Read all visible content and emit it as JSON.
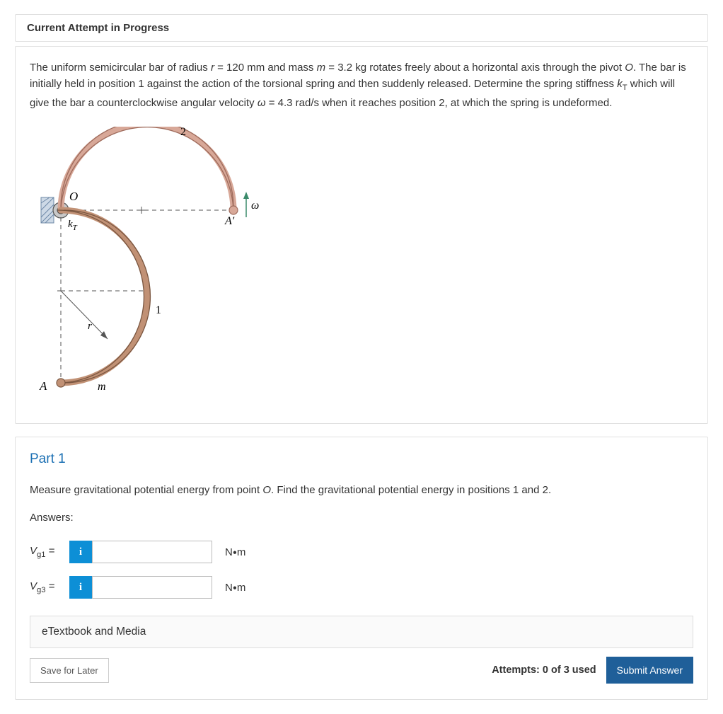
{
  "header": "Current Attempt in Progress",
  "problem": {
    "text_pre": "The uniform semicircular bar of radius ",
    "r_sym": "r",
    "r_eq": " = 120 mm and mass ",
    "m_sym": "m",
    "m_eq": " = 3.2 kg rotates freely about a horizontal axis through the pivot ",
    "O": "O",
    "text_mid1": ". The bar is initially held in position 1 against the action of the torsional spring and then suddenly released. Determine the spring stiffness ",
    "kT_sym": "k",
    "kT_sub": "T",
    "text_mid2": " which will give the bar a counterclockwise angular velocity ",
    "w_sym": "ω",
    "w_eq": " = 4.3 rad/s when it reaches position 2, at which the spring is undeformed."
  },
  "figure": {
    "label_O": "O",
    "label_kT": "k",
    "label_kT_sub": "T",
    "label_2": "2",
    "label_omega": "ω",
    "label_Ap": "A′",
    "label_1": "1",
    "label_r": "r",
    "label_A": "A",
    "label_m": "m"
  },
  "part1": {
    "title": "Part 1",
    "instruction_pre": "Measure gravitational potential energy from point ",
    "instruction_O": "O",
    "instruction_post": ". Find the gravitational potential energy in positions 1 and 2.",
    "answers_label": "Answers:",
    "rows": [
      {
        "sym": "V",
        "sub": "g1",
        "eq": " =",
        "unit_pre": "N",
        "unit_post": "m"
      },
      {
        "sym": "V",
        "sub": "g3",
        "eq": " =",
        "unit_pre": "N",
        "unit_post": "m"
      }
    ],
    "info_glyph": "i"
  },
  "etextbook": "eTextbook and Media",
  "footer": {
    "save": "Save for Later",
    "attempts": "Attempts: 0 of 3 used",
    "submit": "Submit Answer"
  }
}
